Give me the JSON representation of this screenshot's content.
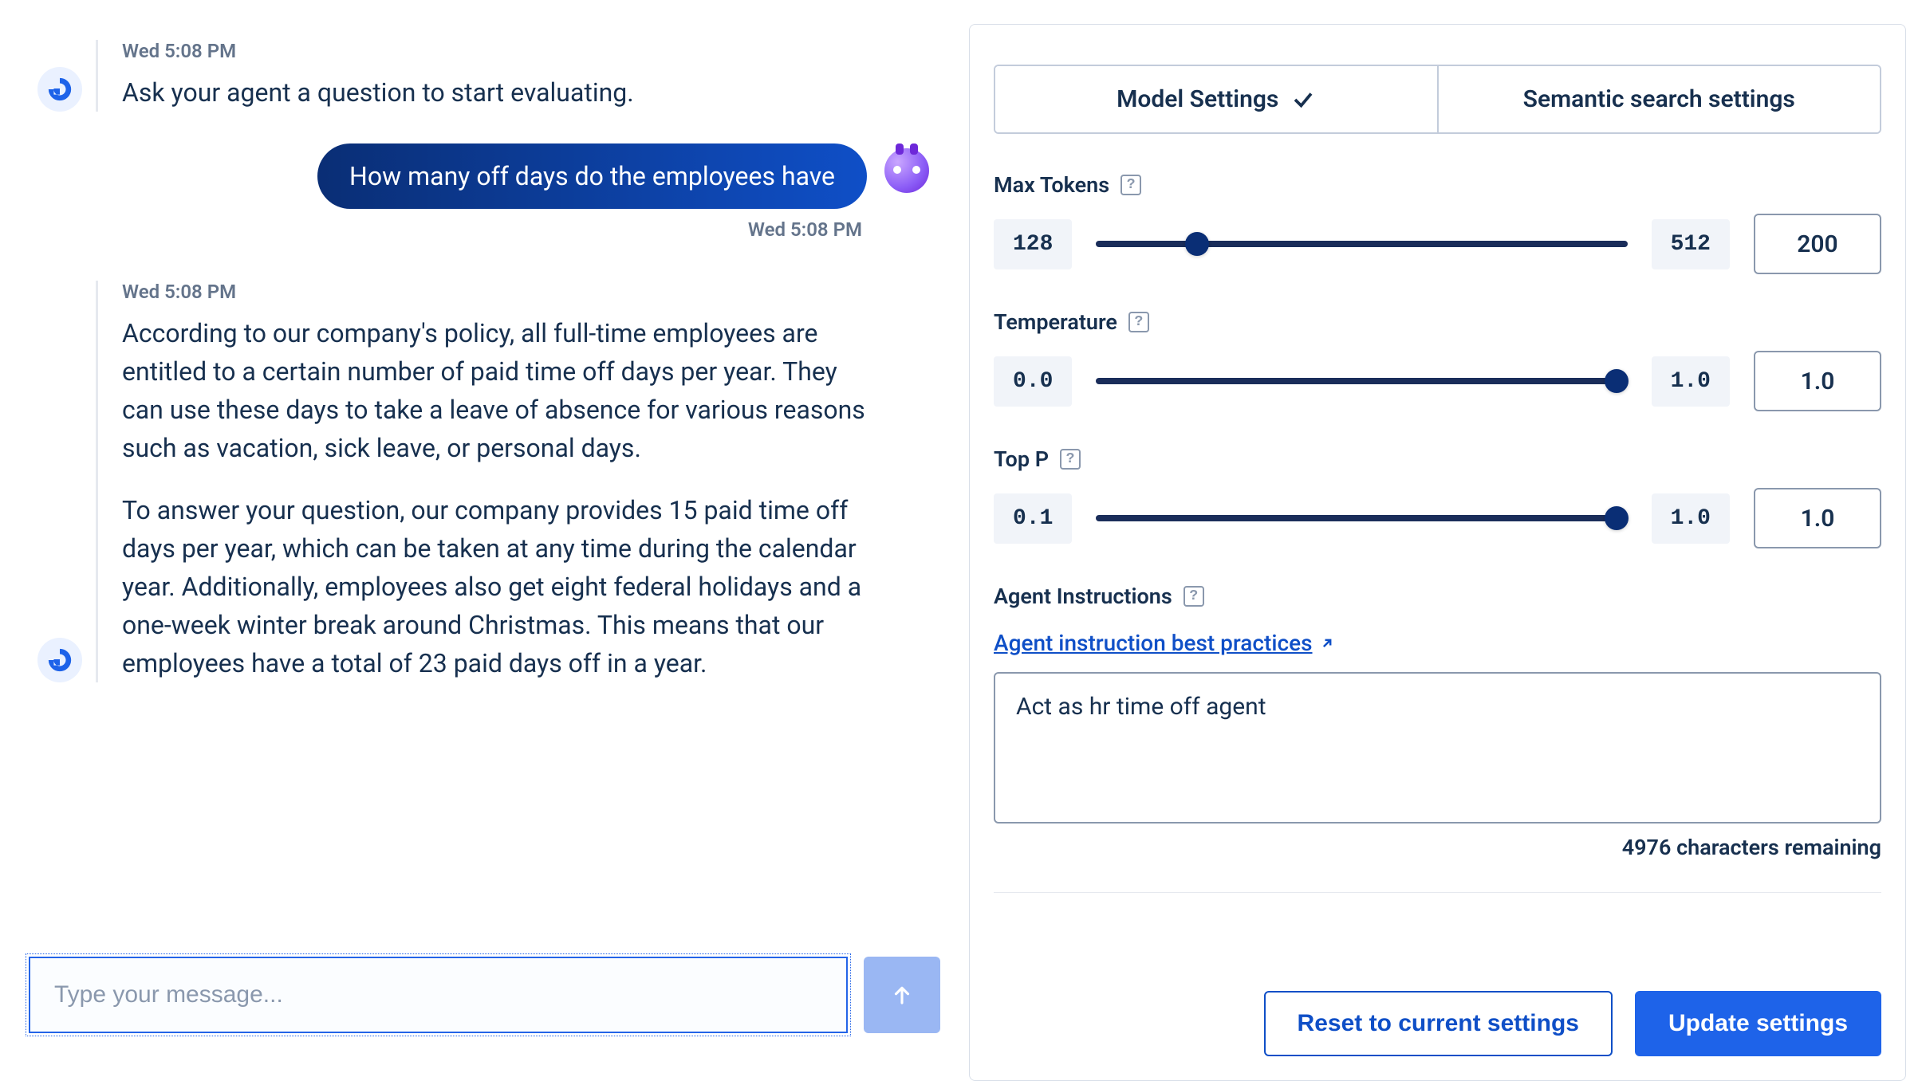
{
  "chat": {
    "system_msg": {
      "timestamp": "Wed 5:08 PM",
      "text": "Ask your agent a question to start evaluating."
    },
    "user_msg": {
      "text": "How many off days do the employees have",
      "timestamp": "Wed 5:08 PM"
    },
    "agent_msg": {
      "timestamp": "Wed 5:08 PM",
      "p1": "According to our company's policy, all full-time employees are entitled to a certain number of paid time off days per year. They can use these days to take a leave of absence for various reasons such as vacation, sick leave, or personal days.",
      "p2": "To answer your question, our company provides 15 paid time off days per year, which can be taken at any time during the calendar year. Additionally, employees also get eight federal holidays and a one-week winter break around Christmas. This means that our employees have a total of 23 paid days off in a year."
    },
    "input_placeholder": "Type your message..."
  },
  "settings": {
    "tabs": {
      "model": "Model Settings",
      "semantic": "Semantic search settings"
    },
    "max_tokens": {
      "label": "Max Tokens",
      "min": "128",
      "max": "512",
      "value": "200",
      "thumb_pct": 19
    },
    "temperature": {
      "label": "Temperature",
      "min": "0.0",
      "max": "1.0",
      "value": "1.0",
      "thumb_pct": 98
    },
    "top_p": {
      "label": "Top P",
      "min": "0.1",
      "max": "1.0",
      "value": "1.0",
      "thumb_pct": 98
    },
    "instructions": {
      "label": "Agent Instructions",
      "link_text": "Agent instruction best practices",
      "value": "Act as hr time off agent",
      "remaining": "4976 characters remaining"
    },
    "actions": {
      "reset": "Reset to current settings",
      "update": "Update settings"
    }
  }
}
